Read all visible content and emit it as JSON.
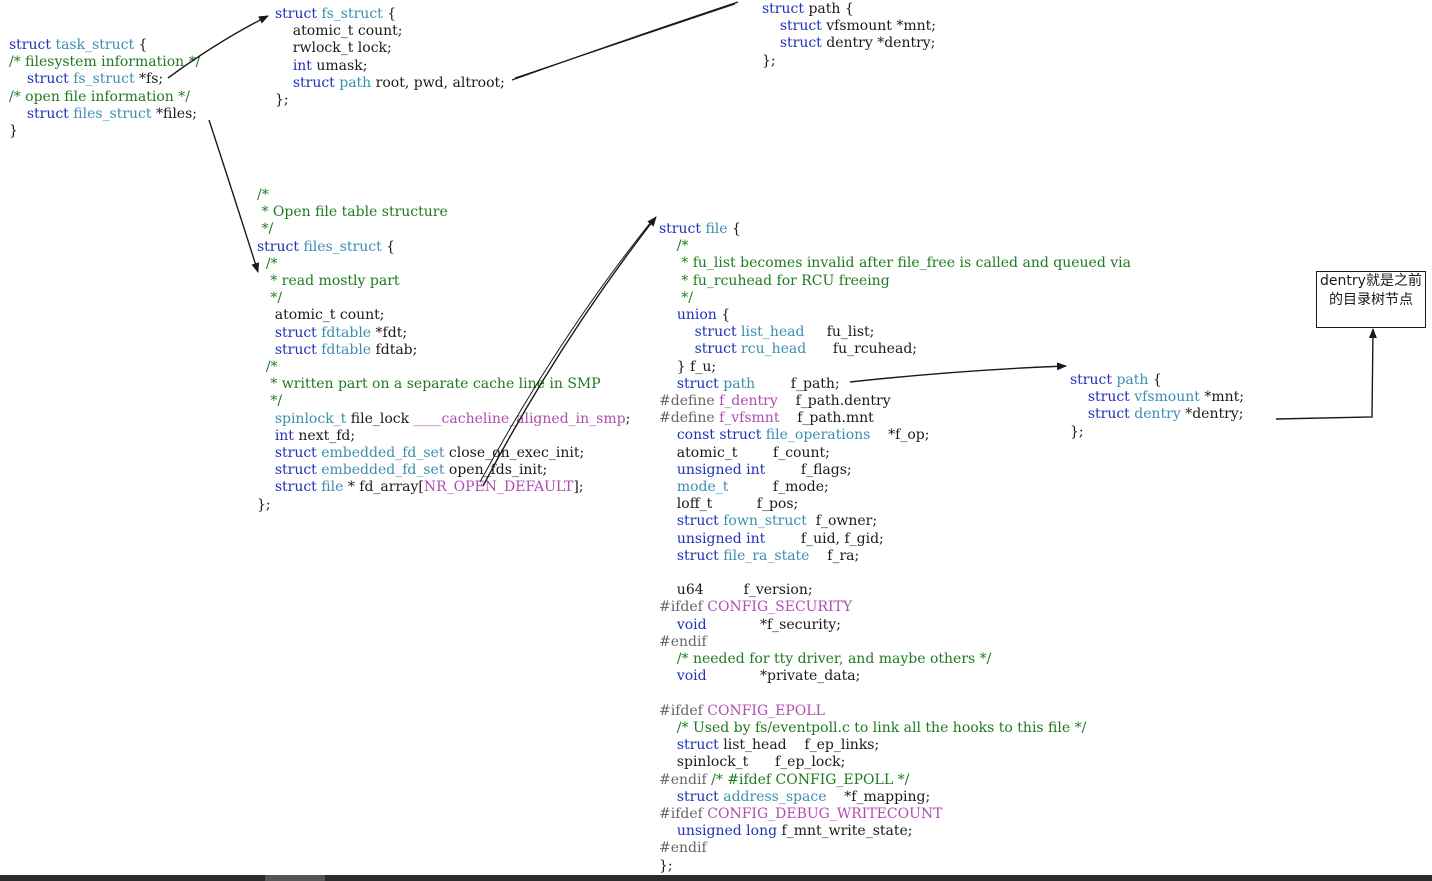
{
  "colors": {
    "plain": "#1a1a1a",
    "keyword": "#1f32b8",
    "type": "#3a8fb0",
    "comment": "#1e7a1e",
    "macro": "#b04cb0",
    "preprocessor": "#666666"
  },
  "note": {
    "text": "dentry就是之前的目录树节点"
  },
  "blocks": {
    "task_struct": [
      [
        [
          "kw",
          "struct "
        ],
        [
          "type",
          "task_struct"
        ],
        [
          "plain",
          " {"
        ]
      ],
      [
        [
          "comment",
          "/* filesystem information */"
        ]
      ],
      [
        [
          "plain",
          "    "
        ],
        [
          "kw",
          "struct "
        ],
        [
          "type",
          "fs_struct"
        ],
        [
          "plain",
          " *fs;"
        ]
      ],
      [
        [
          "comment",
          "/* open file information */"
        ]
      ],
      [
        [
          "plain",
          "    "
        ],
        [
          "kw",
          "struct "
        ],
        [
          "type",
          "files_struct"
        ],
        [
          "plain",
          " *files;"
        ]
      ],
      [
        [
          "plain",
          "}"
        ]
      ]
    ],
    "fs_struct": [
      [
        [
          "kw",
          "struct "
        ],
        [
          "type",
          "fs_struct"
        ],
        [
          "plain",
          " {"
        ]
      ],
      [
        [
          "plain",
          "    atomic_t count;"
        ]
      ],
      [
        [
          "plain",
          "    rwlock_t lock;"
        ]
      ],
      [
        [
          "plain",
          "    "
        ],
        [
          "kw",
          "int"
        ],
        [
          "plain",
          " umask;"
        ]
      ],
      [
        [
          "plain",
          "    "
        ],
        [
          "kw",
          "struct "
        ],
        [
          "type",
          "path"
        ],
        [
          "plain",
          " root, pwd, altroot;"
        ]
      ],
      [
        [
          "plain",
          "};"
        ]
      ]
    ],
    "path_top": [
      [
        [
          "kw",
          "struct "
        ],
        [
          "plain",
          "path {"
        ]
      ],
      [
        [
          "plain",
          "    "
        ],
        [
          "kw",
          "struct "
        ],
        [
          "plain",
          "vfsmount *mnt;"
        ]
      ],
      [
        [
          "plain",
          "    "
        ],
        [
          "kw",
          "struct "
        ],
        [
          "plain",
          "dentry *dentry;"
        ]
      ],
      [
        [
          "plain",
          "};"
        ]
      ]
    ],
    "files_struct": [
      [
        [
          "comment",
          "/*"
        ]
      ],
      [
        [
          "comment",
          " * Open file table structure"
        ]
      ],
      [
        [
          "comment",
          " */"
        ]
      ],
      [
        [
          "kw",
          "struct "
        ],
        [
          "type",
          "files_struct"
        ],
        [
          "plain",
          " {"
        ]
      ],
      [
        [
          "comment",
          "  /*"
        ]
      ],
      [
        [
          "comment",
          "   * read mostly part"
        ]
      ],
      [
        [
          "comment",
          "   */"
        ]
      ],
      [
        [
          "plain",
          "    atomic_t count;"
        ]
      ],
      [
        [
          "plain",
          "    "
        ],
        [
          "kw",
          "struct "
        ],
        [
          "type",
          "fdtable"
        ],
        [
          "plain",
          " *fdt;"
        ]
      ],
      [
        [
          "plain",
          "    "
        ],
        [
          "kw",
          "struct "
        ],
        [
          "type",
          "fdtable"
        ],
        [
          "plain",
          " fdtab;"
        ]
      ],
      [
        [
          "comment",
          "  /*"
        ]
      ],
      [
        [
          "comment",
          "   * written part on a separate cache line in SMP"
        ]
      ],
      [
        [
          "comment",
          "   */"
        ]
      ],
      [
        [
          "plain",
          "    "
        ],
        [
          "type",
          "spinlock_t"
        ],
        [
          "plain",
          " file_lock "
        ],
        [
          "macro",
          "____cacheline_aligned_in_smp"
        ],
        [
          "plain",
          ";"
        ]
      ],
      [
        [
          "plain",
          "    "
        ],
        [
          "kw",
          "int"
        ],
        [
          "plain",
          " next_fd;"
        ]
      ],
      [
        [
          "plain",
          "    "
        ],
        [
          "kw",
          "struct "
        ],
        [
          "type",
          "embedded_fd_set"
        ],
        [
          "plain",
          " close_on_exec_init;"
        ]
      ],
      [
        [
          "plain",
          "    "
        ],
        [
          "kw",
          "struct "
        ],
        [
          "type",
          "embedded_fd_set"
        ],
        [
          "plain",
          " open_fds_init;"
        ]
      ],
      [
        [
          "plain",
          "    "
        ],
        [
          "kw",
          "struct "
        ],
        [
          "type",
          "file"
        ],
        [
          "plain",
          " * fd_array["
        ],
        [
          "macro",
          "NR_OPEN_DEFAULT"
        ],
        [
          "plain",
          "];"
        ]
      ],
      [
        [
          "plain",
          "};"
        ]
      ]
    ],
    "file_struct": [
      [
        [
          "kw",
          "struct "
        ],
        [
          "type",
          "file"
        ],
        [
          "plain",
          " {"
        ]
      ],
      [
        [
          "comment",
          "    /*"
        ]
      ],
      [
        [
          "comment",
          "     * fu_list becomes invalid after file_free is called and queued via"
        ]
      ],
      [
        [
          "comment",
          "     * fu_rcuhead for RCU freeing"
        ]
      ],
      [
        [
          "comment",
          "     */"
        ]
      ],
      [
        [
          "plain",
          "    "
        ],
        [
          "kw",
          "union"
        ],
        [
          "plain",
          " {"
        ]
      ],
      [
        [
          "plain",
          "        "
        ],
        [
          "kw",
          "struct "
        ],
        [
          "type",
          "list_head"
        ],
        [
          "plain",
          "     fu_list;"
        ]
      ],
      [
        [
          "plain",
          "        "
        ],
        [
          "kw",
          "struct "
        ],
        [
          "type",
          "rcu_head"
        ],
        [
          "plain",
          "      fu_rcuhead;"
        ]
      ],
      [
        [
          "plain",
          "    } f_u;"
        ]
      ],
      [
        [
          "plain",
          "    "
        ],
        [
          "kw",
          "struct "
        ],
        [
          "type",
          "path"
        ],
        [
          "plain",
          "        f_path;"
        ]
      ],
      [
        [
          "pre",
          "#define "
        ],
        [
          "macro",
          "f_dentry"
        ],
        [
          "plain",
          "    f_path.dentry"
        ]
      ],
      [
        [
          "pre",
          "#define "
        ],
        [
          "macro",
          "f_vfsmnt"
        ],
        [
          "plain",
          "    f_path.mnt"
        ]
      ],
      [
        [
          "plain",
          "    "
        ],
        [
          "kw",
          "const struct "
        ],
        [
          "type",
          "file_operations"
        ],
        [
          "plain",
          "    *f_op;"
        ]
      ],
      [
        [
          "plain",
          "    atomic_t        f_count;"
        ]
      ],
      [
        [
          "plain",
          "    "
        ],
        [
          "kw",
          "unsigned int"
        ],
        [
          "plain",
          "        f_flags;"
        ]
      ],
      [
        [
          "plain",
          "    "
        ],
        [
          "type",
          "mode_t"
        ],
        [
          "plain",
          "          f_mode;"
        ]
      ],
      [
        [
          "plain",
          "    loff_t          f_pos;"
        ]
      ],
      [
        [
          "plain",
          "    "
        ],
        [
          "kw",
          "struct "
        ],
        [
          "type",
          "fown_struct"
        ],
        [
          "plain",
          "  f_owner;"
        ]
      ],
      [
        [
          "plain",
          "    "
        ],
        [
          "kw",
          "unsigned int"
        ],
        [
          "plain",
          "        f_uid, f_gid;"
        ]
      ],
      [
        [
          "plain",
          "    "
        ],
        [
          "kw",
          "struct "
        ],
        [
          "type",
          "file_ra_state"
        ],
        [
          "plain",
          "    f_ra;"
        ]
      ],
      [
        [
          "plain",
          ""
        ]
      ],
      [
        [
          "plain",
          "    u64         f_version;"
        ]
      ],
      [
        [
          "pre",
          "#ifdef "
        ],
        [
          "macro",
          "CONFIG_SECURITY"
        ]
      ],
      [
        [
          "plain",
          "    "
        ],
        [
          "kw",
          "void"
        ],
        [
          "plain",
          "            *f_security;"
        ]
      ],
      [
        [
          "pre",
          "#endif"
        ]
      ],
      [
        [
          "comment",
          "    /* needed for tty driver, and maybe others */"
        ]
      ],
      [
        [
          "plain",
          "    "
        ],
        [
          "kw",
          "void"
        ],
        [
          "plain",
          "            *private_data;"
        ]
      ],
      [
        [
          "plain",
          ""
        ]
      ],
      [
        [
          "pre",
          "#ifdef "
        ],
        [
          "macro",
          "CONFIG_EPOLL"
        ]
      ],
      [
        [
          "comment",
          "    /* Used by fs/eventpoll.c to link all the hooks to this file */"
        ]
      ],
      [
        [
          "plain",
          "    "
        ],
        [
          "kw",
          "struct "
        ],
        [
          "plain",
          "list_head    f_ep_links;"
        ]
      ],
      [
        [
          "plain",
          "    spinlock_t      f_ep_lock;"
        ]
      ],
      [
        [
          "pre",
          "#endif "
        ],
        [
          "comment",
          "/* #ifdef CONFIG_EPOLL */"
        ]
      ],
      [
        [
          "plain",
          "    "
        ],
        [
          "kw",
          "struct "
        ],
        [
          "type",
          "address_space"
        ],
        [
          "plain",
          "    *f_mapping;"
        ]
      ],
      [
        [
          "pre",
          "#ifdef "
        ],
        [
          "macro",
          "CONFIG_DEBUG_WRITECOUNT"
        ]
      ],
      [
        [
          "plain",
          "    "
        ],
        [
          "kw",
          "unsigned long"
        ],
        [
          "plain",
          " f_mnt_write_state;"
        ]
      ],
      [
        [
          "pre",
          "#endif"
        ]
      ],
      [
        [
          "plain",
          "};"
        ]
      ]
    ],
    "path_right": [
      [
        [
          "kw",
          "struct "
        ],
        [
          "type",
          "path"
        ],
        [
          "plain",
          " {"
        ]
      ],
      [
        [
          "plain",
          "    "
        ],
        [
          "kw",
          "struct "
        ],
        [
          "type",
          "vfsmount"
        ],
        [
          "plain",
          " *mnt;"
        ]
      ],
      [
        [
          "plain",
          "    "
        ],
        [
          "kw",
          "struct "
        ],
        [
          "type",
          "dentry"
        ],
        [
          "plain",
          " *dentry;"
        ]
      ],
      [
        [
          "plain",
          "};"
        ]
      ]
    ]
  }
}
